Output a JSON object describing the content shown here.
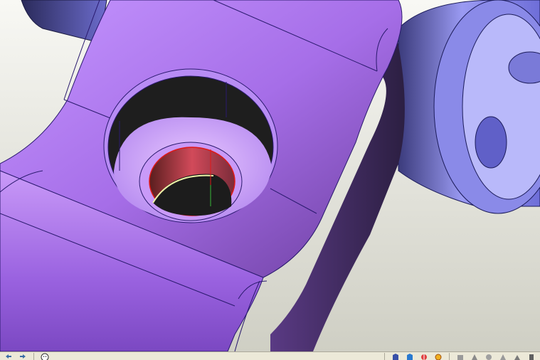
{
  "viewport": {
    "background_top": "#ffffff",
    "background_bottom": "#d6d6cc",
    "part_color": "#b77ff2",
    "part_shadow": "#3a2a52",
    "edge_color": "#2a1a6e",
    "bearing_color": "#8f8ff0",
    "bore_inner_color": "#1c1c1c",
    "selected_edge_color": "#e01818",
    "highlight_edge_color": "#e8f0a0"
  },
  "toolbar": {
    "icons": [
      "undo-arrow-icon",
      "redo-arrow-icon",
      "smiley-face-icon",
      "view-orientation-icon",
      "view-iso-icon",
      "section-view-icon",
      "appearance-icon",
      "hide-show-icon",
      "rotate-view-icon",
      "zoom-icon",
      "pan-icon",
      "display-style-icon",
      "measure-icon"
    ]
  }
}
